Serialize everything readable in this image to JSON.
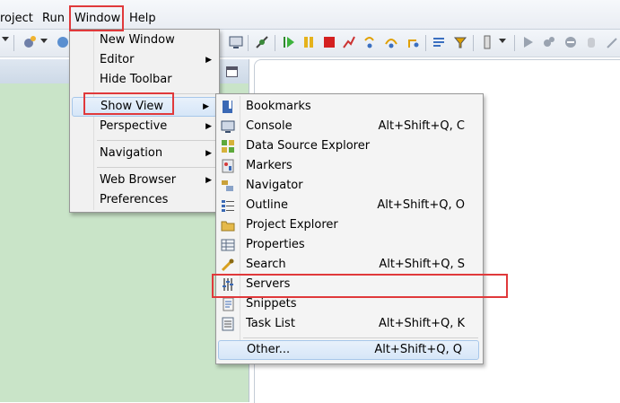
{
  "menubar": {
    "items": [
      {
        "label": "roject"
      },
      {
        "label": "Run"
      },
      {
        "label": "Window"
      },
      {
        "label": "Help"
      }
    ]
  },
  "window_menu": {
    "items": [
      {
        "label": "New Window"
      },
      {
        "label": "Editor",
        "submenu": true
      },
      {
        "label": "Hide Toolbar"
      },
      {
        "label": "Show View",
        "submenu": true
      },
      {
        "label": "Perspective",
        "submenu": true
      },
      {
        "label": "Navigation",
        "submenu": true
      },
      {
        "label": "Web Browser",
        "submenu": true
      },
      {
        "label": "Preferences"
      }
    ]
  },
  "showview_menu": {
    "items": [
      {
        "label": "Bookmarks",
        "shortcut": "",
        "icon": "bookmarks-icon"
      },
      {
        "label": "Console",
        "shortcut": "Alt+Shift+Q, C",
        "icon": "console-icon"
      },
      {
        "label": "Data Source Explorer",
        "shortcut": "",
        "icon": "data-source-explorer-icon"
      },
      {
        "label": "Markers",
        "shortcut": "",
        "icon": "markers-icon"
      },
      {
        "label": "Navigator",
        "shortcut": "",
        "icon": "navigator-icon"
      },
      {
        "label": "Outline",
        "shortcut": "Alt+Shift+Q, O",
        "icon": "outline-icon"
      },
      {
        "label": "Project Explorer",
        "shortcut": "",
        "icon": "project-explorer-icon"
      },
      {
        "label": "Properties",
        "shortcut": "",
        "icon": "properties-icon"
      },
      {
        "label": "Search",
        "shortcut": "Alt+Shift+Q, S",
        "icon": "search-icon"
      },
      {
        "label": "Servers",
        "shortcut": "",
        "icon": "servers-icon"
      },
      {
        "label": "Snippets",
        "shortcut": "",
        "icon": "snippets-icon"
      },
      {
        "label": "Task List",
        "shortcut": "Alt+Shift+Q, K",
        "icon": "task-list-icon"
      },
      {
        "label": "Other...",
        "shortcut": "Alt+Shift+Q, Q",
        "icon": ""
      }
    ]
  },
  "colors": {
    "highlight_box": "#e0393b",
    "left_pane_bg": "#c9e4c8",
    "menu_bg": "#f1f1f1"
  }
}
